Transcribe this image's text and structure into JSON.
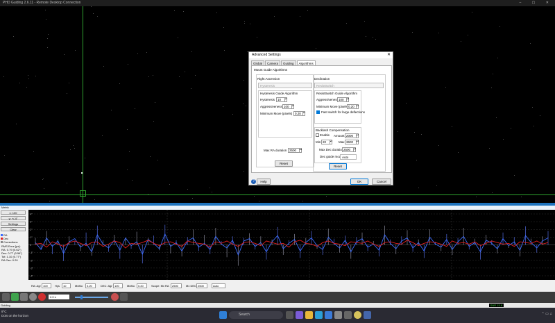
{
  "window": {
    "title": "PHD Guiding 2.6.11 - Remote Desktop Connection"
  },
  "dialog": {
    "title": "Advanced Settings",
    "tabs": [
      "Global",
      "Camera",
      "Guiding",
      "Algorithms"
    ],
    "active_tab": "Algorithms",
    "section": "Mount Guide Algorithms",
    "ra": {
      "heading": "Right Ascension",
      "algorithm": "Hysteresis",
      "group_title": "Hysteresis Guide Algorithm",
      "hysteresis_label": "Hysteresis",
      "hysteresis_value": "10",
      "aggressiveness_label": "Aggressiveness",
      "aggressiveness_value": "100",
      "min_move_label": "Minimum Move (pixels)",
      "min_move_value": "0.20",
      "max_duration_label": "Max RA duration",
      "max_duration_value": "2500",
      "reset": "Reset"
    },
    "dec": {
      "heading": "Declination",
      "algorithm": "ResistSwitch",
      "group_title": "ResistSwitch Guide Algorithm",
      "aggressiveness_label": "Aggressiveness",
      "aggressiveness_value": "100",
      "min_move_label": "Minimum Move (pixels)",
      "min_move_value": "0.20",
      "fast_switch_label": "Fast switch for large deflections",
      "fast_switch_checked": true,
      "backlash_title": "Backlash Compensation",
      "enable_label": "Enable",
      "amount_label": "Amount",
      "amount_value": "2000",
      "min_label": "Min",
      "min_value": "20",
      "max_label": "Max",
      "max_value": "3600",
      "max_duration_label": "Max Dec duration",
      "max_duration_value": "2500",
      "guide_mode_label": "Dec guide mode",
      "guide_mode_value": "Auto",
      "reset": "Reset"
    },
    "help": "Help",
    "ok": "OK",
    "cancel": "Cancel"
  },
  "graph": {
    "panel_title": "Metric",
    "x_scale": "x: 100",
    "y_scale": "y: +/-4\"",
    "settings": "Settings",
    "clear": "Clear",
    "legend_ra": "RA",
    "legend_dec": "Dec",
    "legend_dithers": "Corrections",
    "y_ticks": [
      "4\"",
      "3\"",
      "2\"",
      "1\"",
      "0",
      "-1\"",
      "-2\"",
      "-3\"",
      "-4\""
    ],
    "ra_color": "#3b6cff",
    "dec_color": "#e02020",
    "rms": {
      "title": "RMS Error [px]:",
      "ra": "RA: 0.79 (0.62\")",
      "dec": "Dec: 0.77 (0.56\")",
      "tot": "Tot: 1.10 (0.77\")",
      "osc": "RA Osc: 0.20"
    }
  },
  "chart_data": {
    "type": "line",
    "ylim": [
      -4,
      4
    ],
    "series": [
      {
        "name": "RA",
        "values": [
          0.3,
          -0.6,
          0.9,
          -0.2,
          0.5,
          -1.1,
          0.4,
          0.8,
          -0.3,
          0.2,
          -0.9,
          1.3,
          0.1,
          -0.4,
          0.6,
          -0.7,
          0.9,
          -0.1,
          0.4,
          -1.2,
          0.7,
          0.2,
          -0.5,
          1.4,
          -0.2,
          0.3,
          -0.8,
          0.5,
          0.9,
          -0.3,
          0.2,
          -0.6,
          1.1,
          0.1,
          -0.4,
          0.6,
          -1.3,
          0.5,
          0.8,
          -0.2,
          0.3,
          -0.9,
          0.4,
          1.2,
          -0.5,
          0.2,
          0.7,
          -0.8,
          0.3,
          0.9,
          -0.1,
          -0.6,
          1.0,
          0.2,
          -0.4,
          0.6,
          -0.9,
          0.4,
          0.8,
          -0.3,
          0.1,
          -0.7,
          1.3,
          0.2,
          -0.5,
          0.5,
          0.9,
          -0.4,
          0.3,
          -0.8,
          1.0,
          0.1,
          -0.3,
          0.7,
          -0.6,
          0.4,
          1.1,
          -0.2,
          0.3,
          -0.9,
          0.6,
          0.2,
          -0.5,
          0.8,
          -0.1,
          0.4,
          -0.7,
          1.2,
          0.3,
          -0.4,
          0.5,
          0.9
        ]
      },
      {
        "name": "Dec",
        "values": [
          0.1,
          0.2,
          -0.3,
          0.4,
          0.1,
          -0.2,
          0.3,
          0.5,
          0.2,
          -0.1,
          0.3,
          0.4,
          -0.2,
          0.1,
          0.5,
          0.3,
          -0.4,
          0.2,
          0.1,
          0.3,
          0.6,
          0.2,
          -0.1,
          0.3,
          0.4,
          0.1,
          -0.2,
          0.5,
          0.3,
          0.2,
          0.1,
          -0.3,
          0.4,
          0.2,
          0.5,
          0.1,
          -0.2,
          0.3,
          0.4,
          0.2,
          -0.1,
          0.5,
          0.3,
          0.1,
          0.2,
          -0.3,
          0.4,
          0.6,
          0.2,
          0.1,
          -0.2,
          0.3,
          0.5,
          0.2,
          0.1,
          -0.1,
          0.4,
          0.3,
          0.2,
          0.5,
          0.1,
          -0.2,
          0.3,
          0.4,
          0.2,
          0.1,
          0.6,
          0.3,
          -0.1,
          0.2,
          0.4,
          0.3,
          0.1,
          -0.2,
          0.5,
          0.2,
          0.3,
          0.1,
          0.4,
          -0.1,
          0.2,
          0.5,
          0.3,
          0.1,
          0.2,
          -0.2,
          0.4,
          0.3,
          0.2,
          0.5,
          0.1,
          0.3
        ]
      }
    ],
    "corrections": [
      0.9,
      -0.6,
      1.8,
      -1.2,
      0.7,
      -2.1,
      1.1,
      0.5,
      -0.8,
      1.6,
      -1.4,
      2.5,
      0.6,
      -0.9,
      1.3,
      -1.8,
      0.8,
      -0.5,
      1.7,
      -2.4,
      0.9,
      1.2,
      -0.7,
      2.6,
      -1.1,
      0.6,
      -1.5,
      1.0,
      2.0,
      -0.8,
      1.3,
      -1.2,
      2.2,
      0.5,
      -1.6,
      1.1,
      -2.7,
      0.9,
      1.5,
      -0.6,
      1.1,
      -1.9,
      0.7,
      2.3,
      -1.3,
      0.6,
      1.4,
      -1.7,
      0.9,
      1.8,
      -0.5,
      -1.3,
      2.1,
      0.8,
      -1.0,
      1.2,
      -1.8,
      1.0,
      1.6,
      -0.8,
      0.5,
      -1.5,
      2.5,
      0.7,
      -1.2,
      1.1,
      1.9,
      -0.9,
      0.7,
      -1.7,
      2.0,
      0.4,
      -0.8,
      1.4,
      -1.3,
      0.9,
      2.2,
      -0.6,
      0.8,
      -1.9,
      1.3,
      0.6,
      -1.1,
      1.6,
      -0.4,
      1.0,
      -1.5,
      2.4,
      0.8,
      -1.0,
      1.1,
      1.8
    ]
  },
  "controls": {
    "ra_aggr_label": "RA: Agr",
    "ra_aggr_value": "100",
    "ra_hys_label": "Hys",
    "ra_hys_value": "10",
    "ra_mnmo_label": "MnMo",
    "ra_mnmo_value": "0.20",
    "dec_aggr_label": "DEC: Agr",
    "dec_aggr_value": "100",
    "dec_mnmo_label": "MnMo",
    "dec_mnmo_value": "0.20",
    "scope_mxra_label": "Scope: Mx RA",
    "scope_mxra_value": "2500",
    "mxdec_label": "Mx DEC",
    "mxdec_value": "2500",
    "decmode_value": "Auto"
  },
  "toolbar": {
    "exposure": "2.0 s"
  },
  "status": {
    "left": "Guiding",
    "snr": "SNR 15.8"
  },
  "taskbar": {
    "temp": "9°C",
    "weather": "Dots on the horizon",
    "search": "Search"
  }
}
